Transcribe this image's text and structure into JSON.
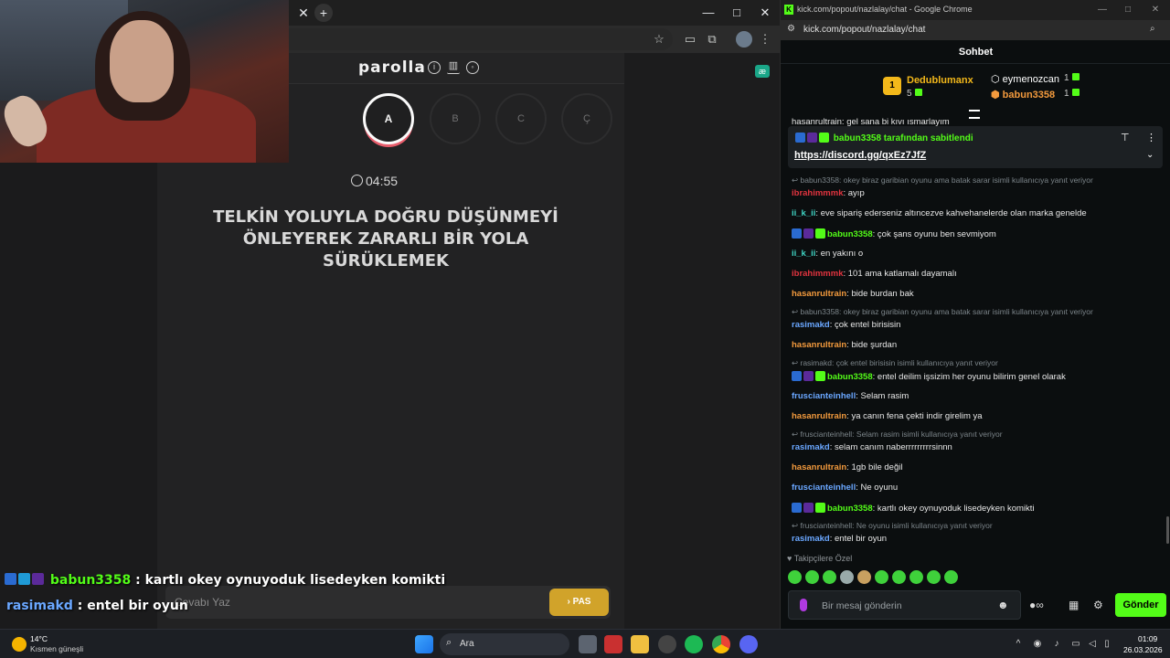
{
  "browser": {
    "win_minimize": "—",
    "win_maximize": "□",
    "win_close": "✕"
  },
  "game": {
    "logo": "parolla",
    "letters": [
      "A",
      "B",
      "C",
      "Ç"
    ],
    "timer": "04:55",
    "question": "TELKİN YOLUYLA DOĞRU DÜŞÜNMEYİ ÖNLEYEREK ZARARLI BİR YOLA SÜRÜKLEMEK",
    "answer_placeholder": "Cevabı Yaz",
    "pass_label": "PAS"
  },
  "overlay": {
    "lines": [
      {
        "user": "babun3358",
        "text": " : kartlı okey oynuyoduk lisedeyken komikti"
      },
      {
        "user": "rasimakd",
        "text": " : entel bir oyun"
      }
    ]
  },
  "chat_window": {
    "title": "kick.com/popout/nazlalay/chat - Google Chrome",
    "url": "kick.com/popout/nazlalay/chat",
    "header": "Sohbet",
    "leaderboard": [
      {
        "rank": "1",
        "name": "Dedublumanx",
        "count": "5"
      },
      {
        "name": "eymenozcan",
        "count": "1"
      },
      {
        "name": "babun3358",
        "count": "1"
      }
    ],
    "pinned_by": "babun3358 tarafından sabitlendi",
    "pinned_link": "https://discord.gg/qxEz7JfZ",
    "top_cut_message": "hasanrultrain: gel sana bi kıvı ısmarlayım",
    "messages": [
      {
        "reply": "babun3358: okey biraz garibian oyunu ama batak sarar isimli kullanıcıya yanıt veriyor"
      },
      {
        "user": "ibrahimmmk",
        "text": ": ayıp",
        "color": "#e2343f"
      },
      {
        "user": "ii_k_ii",
        "text": ": eve sipariş ederseniz altıncezve kahvehanelerde olan marka genelde",
        "color": "#3fd4c4"
      },
      {
        "user": "babun3358",
        "text": ": çok şans oyunu ben sevmiyom",
        "color": "#53fc18",
        "badges": true
      },
      {
        "user": "ii_k_ii",
        "text": ": en yakını o",
        "color": "#3fd4c4"
      },
      {
        "user": "ibrahimmmk",
        "text": ": 101 ama katlamalı dayamalı",
        "color": "#e2343f"
      },
      {
        "user": "hasanrultrain",
        "text": ": bide burdan bak",
        "color": "#f39a3d"
      },
      {
        "reply": "babun3358: okey biraz garibian oyunu ama batak sarar isimli kullanıcıya yanıt veriyor"
      },
      {
        "user": "rasimakd",
        "text": ": çok entel birisisin",
        "color": "#6aa7ff"
      },
      {
        "user": "hasanrultrain",
        "text": ": bide şurdan",
        "color": "#f39a3d"
      },
      {
        "reply": "rasimakd: çok entel birisisin isimli kullanıcıya yanıt veriyor"
      },
      {
        "user": "babun3358",
        "text": ": entel deilim işsizim her oyunu bilirim genel olarak",
        "color": "#53fc18",
        "badges": true
      },
      {
        "user": "fruscianteinhell",
        "text": ": Selam rasim",
        "color": "#6aa7ff"
      },
      {
        "user": "hasanrultrain",
        "text": ": ya canın fena çekti indir girelim ya",
        "color": "#f39a3d"
      },
      {
        "reply": "fruscianteinhell: Selam rasim isimli kullanıcıya yanıt veriyor"
      },
      {
        "user": "rasimakd",
        "text": ": selam canım naberrrrrrrrrsinnn",
        "color": "#6aa7ff"
      },
      {
        "user": "hasanrultrain",
        "text": ": 1gb bile değil",
        "color": "#f39a3d"
      },
      {
        "user": "fruscianteinhell",
        "text": ": Ne oyunu",
        "color": "#6aa7ff"
      },
      {
        "user": "babun3358",
        "text": ": kartlı okey oynuyoduk lisedeyken komikti",
        "color": "#53fc18",
        "badges": true
      },
      {
        "reply": "fruscianteinhell: Ne oyunu isimli kullanıcıya yanıt veriyor"
      },
      {
        "user": "rasimakd",
        "text": ": entel bir oyun",
        "color": "#6aa7ff"
      }
    ],
    "followers_label": "Takipçilere Özel",
    "input_placeholder": "Bir mesaj gönderin",
    "send_label": "Gönder"
  },
  "taskbar": {
    "weather_temp": "14°C",
    "weather_desc": "Kısmen güneşli",
    "search_label": "Ara",
    "time": "01:09",
    "date": "26.03.2026"
  },
  "colors": {
    "kick_green": "#53fc18",
    "pass_yellow": "#d1a32a",
    "letter_ring": "#e85d6c"
  }
}
